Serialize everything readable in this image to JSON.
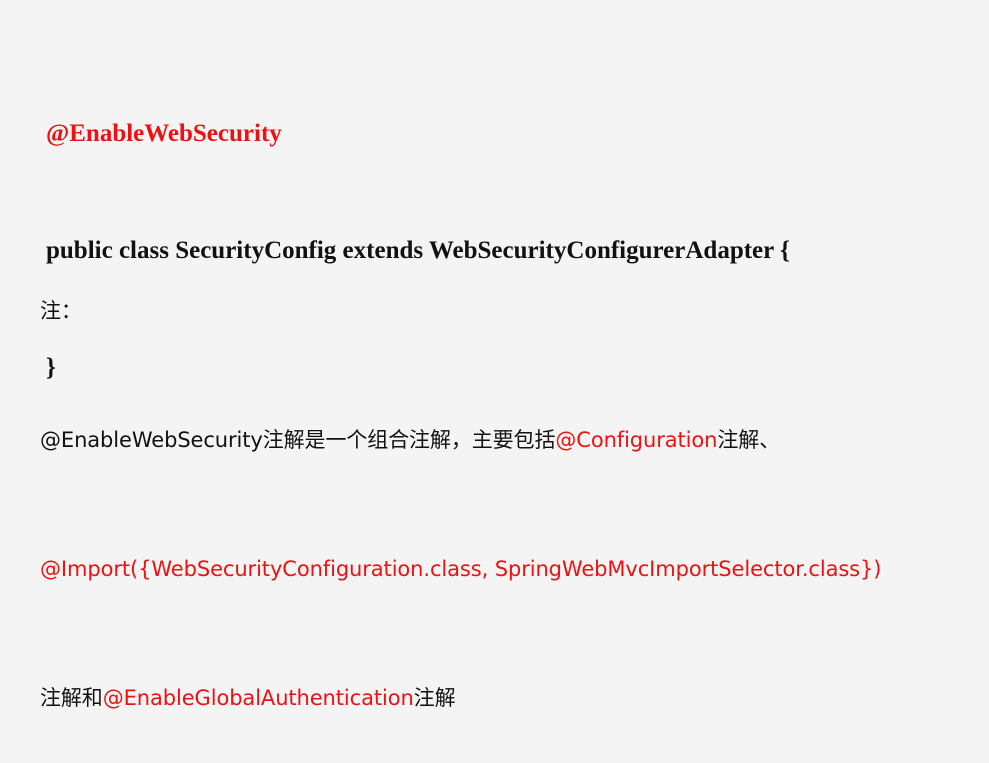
{
  "code": {
    "annotation": "@EnableWebSecurity",
    "class_declaration": "public class SecurityConfig extends WebSecurityConfigurerAdapter {",
    "closing_brace": "}"
  },
  "note": {
    "heading": "注：",
    "line1": {
      "part1": "@EnableWebSecurity注解是一个组合注解，主要包括",
      "part2_red": "@Configuration",
      "part3": "注解、"
    },
    "line2_red": "@Import({WebSecurityConfiguration.class, SpringWebMvcImportSelector.class})",
    "line3": {
      "part1": "注解和",
      "part2_red": "@EnableGlobalAuthentication",
      "part3": "注解"
    }
  },
  "colors": {
    "background": "#f4f4f4",
    "text": "#111111",
    "highlight": "#ee1111"
  }
}
